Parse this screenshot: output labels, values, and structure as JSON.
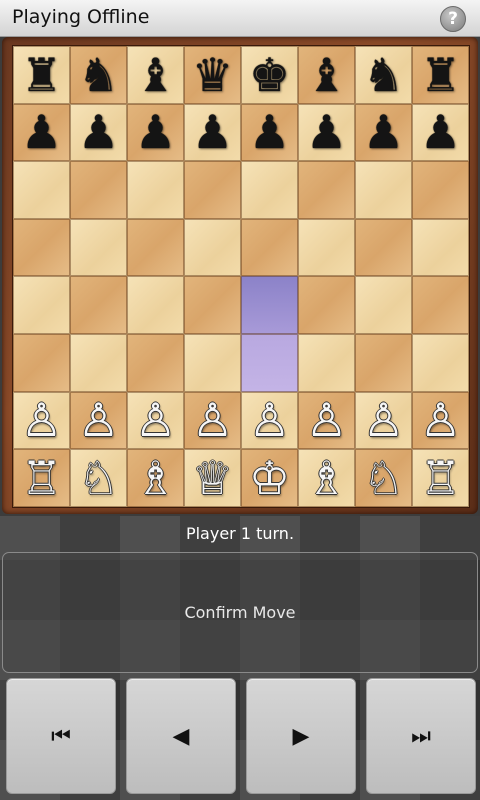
{
  "header": {
    "title": "Playing Offline",
    "help_icon": "?"
  },
  "board": {
    "highlight_squares": [
      "e3",
      "e4"
    ],
    "ranks": [
      [
        {
          "p": "♜",
          "c": "black",
          "n": "rook"
        },
        {
          "p": "♞",
          "c": "black",
          "n": "knight"
        },
        {
          "p": "♝",
          "c": "black",
          "n": "bishop"
        },
        {
          "p": "♛",
          "c": "black",
          "n": "queen"
        },
        {
          "p": "♚",
          "c": "black",
          "n": "king"
        },
        {
          "p": "♝",
          "c": "black",
          "n": "bishop"
        },
        {
          "p": "♞",
          "c": "black",
          "n": "knight"
        },
        {
          "p": "♜",
          "c": "black",
          "n": "rook"
        }
      ],
      [
        {
          "p": "♟",
          "c": "black",
          "n": "pawn"
        },
        {
          "p": "♟",
          "c": "black",
          "n": "pawn"
        },
        {
          "p": "♟",
          "c": "black",
          "n": "pawn"
        },
        {
          "p": "♟",
          "c": "black",
          "n": "pawn"
        },
        {
          "p": "♟",
          "c": "black",
          "n": "pawn"
        },
        {
          "p": "♟",
          "c": "black",
          "n": "pawn"
        },
        {
          "p": "♟",
          "c": "black",
          "n": "pawn"
        },
        {
          "p": "♟",
          "c": "black",
          "n": "pawn"
        }
      ],
      [
        null,
        null,
        null,
        null,
        null,
        null,
        null,
        null
      ],
      [
        null,
        null,
        null,
        null,
        null,
        null,
        null,
        null
      ],
      [
        null,
        null,
        null,
        null,
        null,
        null,
        null,
        null
      ],
      [
        null,
        null,
        null,
        null,
        null,
        null,
        null,
        null
      ],
      [
        {
          "p": "♙",
          "c": "white",
          "n": "pawn"
        },
        {
          "p": "♙",
          "c": "white",
          "n": "pawn"
        },
        {
          "p": "♙",
          "c": "white",
          "n": "pawn"
        },
        {
          "p": "♙",
          "c": "white",
          "n": "pawn"
        },
        {
          "p": "♙",
          "c": "white",
          "n": "pawn"
        },
        {
          "p": "♙",
          "c": "white",
          "n": "pawn"
        },
        {
          "p": "♙",
          "c": "white",
          "n": "pawn"
        },
        {
          "p": "♙",
          "c": "white",
          "n": "pawn"
        }
      ],
      [
        {
          "p": "♖",
          "c": "white",
          "n": "rook"
        },
        {
          "p": "♘",
          "c": "white",
          "n": "knight"
        },
        {
          "p": "♗",
          "c": "white",
          "n": "bishop"
        },
        {
          "p": "♕",
          "c": "white",
          "n": "queen"
        },
        {
          "p": "♔",
          "c": "white",
          "n": "king"
        },
        {
          "p": "♗",
          "c": "white",
          "n": "bishop"
        },
        {
          "p": "♘",
          "c": "white",
          "n": "knight"
        },
        {
          "p": "♖",
          "c": "white",
          "n": "rook"
        }
      ]
    ]
  },
  "status": {
    "text": "Player 1 turn."
  },
  "confirm": {
    "label": "Confirm Move"
  },
  "controls": {
    "first_icon": "⏮",
    "prev_icon": "◀",
    "next_icon": "▶",
    "last_icon": "⏭"
  },
  "colors": {
    "highlight": "#8b82c8",
    "light_square": "#f6e3b8",
    "dark_square": "#d9a56a",
    "frame": "#6a3820"
  }
}
